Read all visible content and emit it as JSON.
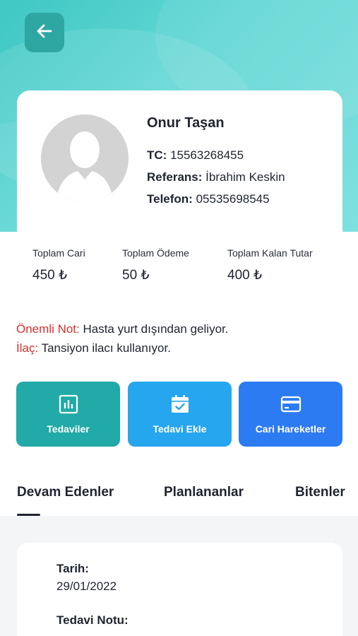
{
  "profile": {
    "name": "Onur Taşan",
    "tc_label": "TC:",
    "tc_value": "15563268455",
    "referans_label": "Referans:",
    "referans_value": "İbrahim Keskin",
    "telefon_label": "Telefon:",
    "telefon_value": "05535698545"
  },
  "totals": [
    {
      "label": "Toplam Cari",
      "value": "450 ₺"
    },
    {
      "label": "Toplam Ödeme",
      "value": "50 ₺"
    },
    {
      "label": "Toplam Kalan Tutar",
      "value": "400 ₺"
    }
  ],
  "notes": {
    "important_key": "Önemli Not:",
    "important_value": " Hasta yurt dışından geliyor.",
    "medicine_key": "İlaç:",
    "medicine_value": " Tansiyon ilacı kullanıyor."
  },
  "actions": [
    {
      "label": "Tedaviler",
      "icon": "chart-icon",
      "color": "#21aaa7"
    },
    {
      "label": "Tedavi Ekle",
      "icon": "calendar-check-icon",
      "color": "#26a6ee"
    },
    {
      "label": "Cari Hareketler",
      "icon": "credit-card-icon",
      "color": "#2d7bf2"
    }
  ],
  "tabs": [
    {
      "label": "Devam Edenler",
      "active": true
    },
    {
      "label": "Planlananlar",
      "active": false
    },
    {
      "label": "Bitenler",
      "active": false
    }
  ],
  "treatment": {
    "date_label": "Tarih:",
    "date_value": "29/01/2022",
    "note_label": "Tedavi Notu:"
  },
  "colors": {
    "header_teal": "#4fcecb",
    "back_button": "#2ea7a3",
    "note_key_red": "#d5302f"
  }
}
